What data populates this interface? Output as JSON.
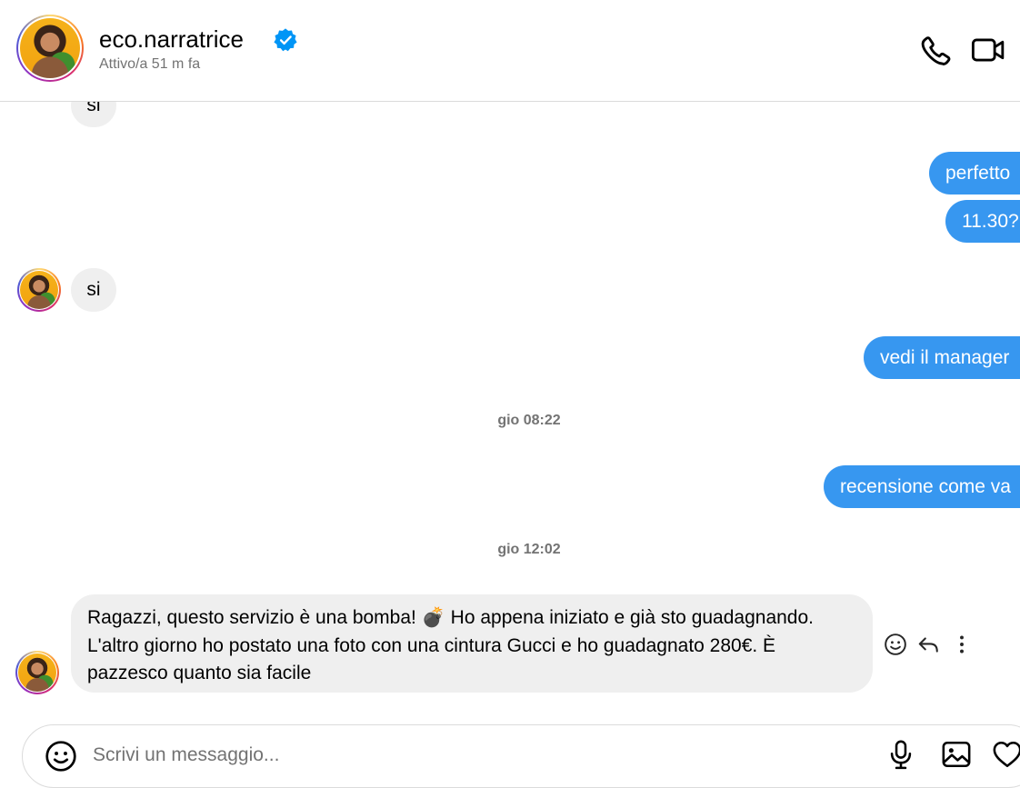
{
  "header": {
    "username": "eco.narratrice",
    "status": "Attivo/a 51 m fa",
    "verified": true,
    "icons": [
      "phone-icon",
      "video-camera-icon"
    ]
  },
  "messages": [
    {
      "side": "in",
      "text": "si"
    },
    {
      "side": "out",
      "text": "perfetto"
    },
    {
      "side": "out",
      "text": "11.30?"
    },
    {
      "side": "in",
      "text": "si"
    },
    {
      "side": "out",
      "text": "vedi il manager"
    },
    {
      "side": "time",
      "text": "gio 08:22"
    },
    {
      "side": "out",
      "text": "recensione come va"
    },
    {
      "side": "time",
      "text": "gio 12:02"
    },
    {
      "side": "in",
      "text": "Ragazzi, questo servizio è una bomba! 💣 Ho appena iniziato e già sto guadagnando. L'altro giorno ho postato una foto con una cintura Gucci e ho guadagnato 280€. È pazzesco quanto sia facile"
    }
  ],
  "message_actions": [
    "smiley-react-icon",
    "reply-icon",
    "more-options-icon"
  ],
  "composer": {
    "placeholder": "Scrivi un messaggio...",
    "icons": [
      "emoji-icon",
      "microphone-icon",
      "image-icon",
      "heart-icon"
    ]
  },
  "colors": {
    "outgoing_bubble": "#3797f0",
    "incoming_bubble": "#efefef",
    "verified_badge": "#0095f6",
    "secondary_text": "#737373"
  }
}
